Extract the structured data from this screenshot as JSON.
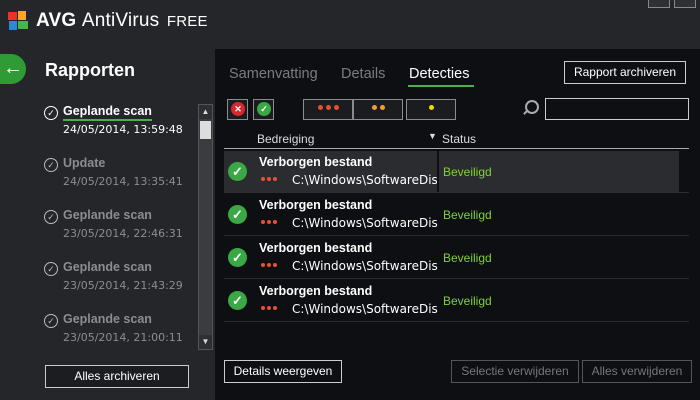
{
  "app": {
    "name": "AVG",
    "product": "AntiVirus",
    "edition": "FREE"
  },
  "left": {
    "title": "Rapporten",
    "reports": [
      {
        "name": "Geplande scan",
        "date": "24/05/2014, 13:59:48",
        "active": true
      },
      {
        "name": "Update",
        "date": "24/05/2014, 13:35:41",
        "active": false
      },
      {
        "name": "Geplande scan",
        "date": "23/05/2014, 22:46:31",
        "active": false
      },
      {
        "name": "Geplande scan",
        "date": "23/05/2014, 21:43:29",
        "active": false
      },
      {
        "name": "Geplande scan",
        "date": "23/05/2014, 21:00:11",
        "active": false
      }
    ],
    "archive_all_label": "Alles archiveren"
  },
  "main": {
    "tabs": [
      {
        "label": "Samenvatting",
        "active": false
      },
      {
        "label": "Details",
        "active": false
      },
      {
        "label": "Detecties",
        "active": true
      }
    ],
    "archive_report_label": "Rapport archiveren",
    "search": {
      "value": "",
      "placeholder": ""
    },
    "columns": {
      "threat": "Bedreiging",
      "status": "Status"
    },
    "rows": [
      {
        "threat": "Verborgen bestand",
        "path": "C:\\Windows\\SoftwareDis...",
        "status": "Beveiligd",
        "selected": true
      },
      {
        "threat": "Verborgen bestand",
        "path": "C:\\Windows\\SoftwareDis...",
        "status": "Beveiligd",
        "selected": false
      },
      {
        "threat": "Verborgen bestand",
        "path": "C:\\Windows\\SoftwareDis...",
        "status": "Beveiligd",
        "selected": false
      },
      {
        "threat": "Verborgen bestand",
        "path": "C:\\Windows\\SoftwareDis...",
        "status": "Beveiligd",
        "selected": false
      }
    ],
    "details_label": "Details weergeven",
    "delete_selection_label": "Selectie verwijderen",
    "delete_all_label": "Alles verwijderen"
  },
  "icons": {
    "back": "arrow-left-icon",
    "report": "check-circle-outline-icon",
    "row": "check-circle-icon",
    "search": "search-icon"
  },
  "colors": {
    "accent_green": "#4caf50",
    "status_green": "#7fd13b",
    "severity_high": "#e8502e",
    "severity_medium": "#f0a030",
    "severity_low": "#f5d800",
    "filter_red": "#d9262c"
  }
}
